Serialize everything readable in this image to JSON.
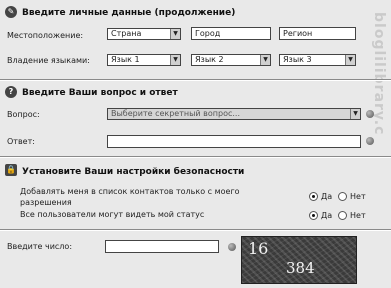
{
  "watermark": "bloglilibrary.c",
  "section1": {
    "title": "Введите личные данные (продолжение)",
    "location_label": "Местоположение:",
    "country": "Страна",
    "city": "Город",
    "region": "Регион",
    "languages_label": "Владение языками:",
    "lang1": "Язык 1",
    "lang2": "Язык 2",
    "lang3": "Язык 3"
  },
  "section2": {
    "title": "Введите Ваши вопрос и ответ",
    "question_label": "Вопрос:",
    "question_value": "Выберите секретный вопрос...",
    "answer_label": "Ответ:",
    "answer_value": ""
  },
  "section3": {
    "title": "Установите Ваши настройки безопасности",
    "add_contacts_label": "Добавлять меня в список контактов только с моего разрешения",
    "show_status_label": "Все пользователи могут видеть мой статус",
    "yes": "Да",
    "no": "Нет",
    "add_contacts_selected": "yes",
    "show_status_selected": "yes"
  },
  "section4": {
    "number_label": "Введите число:",
    "number_value": "",
    "captcha_line1": "16",
    "captcha_line2": "384"
  }
}
